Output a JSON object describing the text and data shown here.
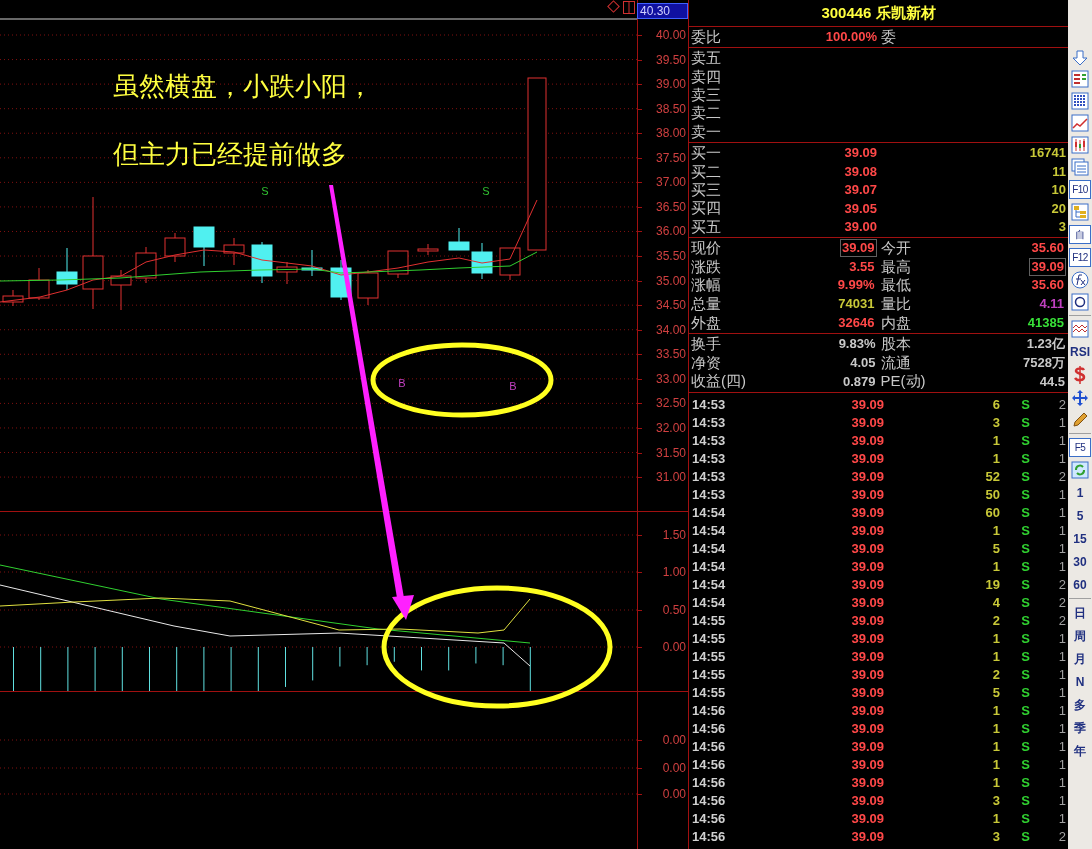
{
  "chart_header": {
    "current_price": "40.30"
  },
  "annotation": {
    "lines": [
      "虽然横盘，小跌小阳，",
      "但主力已经提前做多"
    ]
  },
  "signals": [
    {
      "kind": "sell",
      "label": "S"
    },
    {
      "kind": "sell",
      "label": "S"
    },
    {
      "kind": "buy",
      "label": "B"
    },
    {
      "kind": "buy",
      "label": "B"
    }
  ],
  "price_axis": {
    "ticks": [
      "40.00",
      "39.50",
      "39.00",
      "38.50",
      "38.00",
      "37.50",
      "37.00",
      "36.50",
      "36.00",
      "35.50",
      "35.00",
      "34.50",
      "34.00",
      "33.50",
      "33.00",
      "32.50",
      "32.00",
      "31.50",
      "31.00"
    ]
  },
  "indicator_axis": {
    "ticks": [
      "1.50",
      "1.00",
      "0.50",
      "0.00"
    ]
  },
  "lower_axis": {
    "ticks": [
      "0.00",
      "0.00",
      "0.00"
    ]
  },
  "quote": {
    "title": "300446 乐凯新材",
    "ratio": {
      "label": "委比",
      "value": "100.00%",
      "next_label": "委"
    },
    "asks": [
      {
        "label": "卖五"
      },
      {
        "label": "卖四"
      },
      {
        "label": "卖三"
      },
      {
        "label": "卖二"
      },
      {
        "label": "卖一"
      }
    ],
    "bids": [
      {
        "label": "买一",
        "price": "39.09",
        "volume": "16741"
      },
      {
        "label": "买二",
        "price": "39.08",
        "volume": "11"
      },
      {
        "label": "买三",
        "price": "39.07",
        "volume": "10"
      },
      {
        "label": "买四",
        "price": "39.05",
        "volume": "20"
      },
      {
        "label": "买五",
        "price": "39.00",
        "volume": "3"
      }
    ],
    "stats": [
      {
        "label": "现价",
        "value": "39.09",
        "color": "#ff4848",
        "boxed": true
      },
      {
        "label": "今开",
        "value": "35.60",
        "color": "#ff4848",
        "boxed": false
      },
      {
        "label": "涨跌",
        "value": "3.55",
        "color": "#ff4848",
        "boxed": false
      },
      {
        "label": "最高",
        "value": "39.09",
        "color": "#ff4848",
        "boxed": true
      },
      {
        "label": "涨幅",
        "value": "9.99%",
        "color": "#ff4848",
        "boxed": false
      },
      {
        "label": "最低",
        "value": "35.60",
        "color": "#ff4848",
        "boxed": false
      },
      {
        "label": "总量",
        "value": "74031",
        "color": "#c8c838",
        "boxed": false
      },
      {
        "label": "量比",
        "value": "4.11",
        "color": "#c040c0",
        "boxed": false
      },
      {
        "label": "外盘",
        "value": "32646",
        "color": "#ff4848",
        "boxed": false
      },
      {
        "label": "内盘",
        "value": "41385",
        "color": "#38e038",
        "boxed": false
      }
    ],
    "fundamentals": [
      {
        "label": "换手",
        "value": "9.83%"
      },
      {
        "label": "股本",
        "value": "1.23亿"
      },
      {
        "label": "净资",
        "value": "4.05"
      },
      {
        "label": "流通",
        "value": "7528万"
      },
      {
        "label": "收益(四)",
        "value": "0.879"
      },
      {
        "label": "PE(动)",
        "value": "44.5"
      }
    ]
  },
  "trades": [
    {
      "time": "14:53",
      "price": "39.09",
      "volume": "6",
      "side": "S",
      "count": "2"
    },
    {
      "time": "14:53",
      "price": "39.09",
      "volume": "3",
      "side": "S",
      "count": "1"
    },
    {
      "time": "14:53",
      "price": "39.09",
      "volume": "1",
      "side": "S",
      "count": "1"
    },
    {
      "time": "14:53",
      "price": "39.09",
      "volume": "1",
      "side": "S",
      "count": "1"
    },
    {
      "time": "14:53",
      "price": "39.09",
      "volume": "52",
      "side": "S",
      "count": "2"
    },
    {
      "time": "14:53",
      "price": "39.09",
      "volume": "50",
      "side": "S",
      "count": "1"
    },
    {
      "time": "14:54",
      "price": "39.09",
      "volume": "60",
      "side": "S",
      "count": "1"
    },
    {
      "time": "14:54",
      "price": "39.09",
      "volume": "1",
      "side": "S",
      "count": "1"
    },
    {
      "time": "14:54",
      "price": "39.09",
      "volume": "5",
      "side": "S",
      "count": "1"
    },
    {
      "time": "14:54",
      "price": "39.09",
      "volume": "1",
      "side": "S",
      "count": "1"
    },
    {
      "time": "14:54",
      "price": "39.09",
      "volume": "19",
      "side": "S",
      "count": "2"
    },
    {
      "time": "14:54",
      "price": "39.09",
      "volume": "4",
      "side": "S",
      "count": "2"
    },
    {
      "time": "14:55",
      "price": "39.09",
      "volume": "2",
      "side": "S",
      "count": "2"
    },
    {
      "time": "14:55",
      "price": "39.09",
      "volume": "1",
      "side": "S",
      "count": "1"
    },
    {
      "time": "14:55",
      "price": "39.09",
      "volume": "1",
      "side": "S",
      "count": "1"
    },
    {
      "time": "14:55",
      "price": "39.09",
      "volume": "2",
      "side": "S",
      "count": "1"
    },
    {
      "time": "14:55",
      "price": "39.09",
      "volume": "5",
      "side": "S",
      "count": "1"
    },
    {
      "time": "14:56",
      "price": "39.09",
      "volume": "1",
      "side": "S",
      "count": "1"
    },
    {
      "time": "14:56",
      "price": "39.09",
      "volume": "1",
      "side": "S",
      "count": "1"
    },
    {
      "time": "14:56",
      "price": "39.09",
      "volume": "1",
      "side": "S",
      "count": "1"
    },
    {
      "time": "14:56",
      "price": "39.09",
      "volume": "1",
      "side": "S",
      "count": "1"
    },
    {
      "time": "14:56",
      "price": "39.09",
      "volume": "1",
      "side": "S",
      "count": "1"
    },
    {
      "time": "14:56",
      "price": "39.09",
      "volume": "3",
      "side": "S",
      "count": "1"
    },
    {
      "time": "14:56",
      "price": "39.09",
      "volume": "1",
      "side": "S",
      "count": "1"
    },
    {
      "time": "14:56",
      "price": "39.09",
      "volume": "3",
      "side": "S",
      "count": "2"
    }
  ],
  "toolbar": [
    {
      "kind": "icon"
    },
    {
      "kind": "icon"
    },
    {
      "kind": "icon"
    },
    {
      "kind": "icon"
    },
    {
      "kind": "icon"
    },
    {
      "kind": "icon"
    },
    {
      "kind": "key",
      "label": "F10"
    },
    {
      "kind": "icon"
    },
    {
      "kind": "key",
      "label": "自"
    },
    {
      "kind": "key",
      "label": "F12"
    },
    {
      "kind": "icon"
    },
    {
      "kind": "icon"
    },
    {
      "kind": "separator"
    },
    {
      "kind": "icon"
    },
    {
      "kind": "period",
      "label": "RSI"
    },
    {
      "kind": "icon"
    },
    {
      "kind": "icon"
    },
    {
      "kind": "icon"
    },
    {
      "kind": "separator"
    },
    {
      "kind": "key",
      "label": "F5"
    },
    {
      "kind": "icon"
    },
    {
      "kind": "period",
      "label": "1"
    },
    {
      "kind": "period",
      "label": "5"
    },
    {
      "kind": "period",
      "label": "15"
    },
    {
      "kind": "period",
      "label": "30"
    },
    {
      "kind": "period",
      "label": "60"
    },
    {
      "kind": "separator"
    },
    {
      "kind": "period",
      "label": "日"
    },
    {
      "kind": "period",
      "label": "周"
    },
    {
      "kind": "period",
      "label": "月"
    },
    {
      "kind": "period",
      "label": "N"
    },
    {
      "kind": "period",
      "label": "多"
    },
    {
      "kind": "period",
      "label": "季"
    },
    {
      "kind": "period",
      "label": "年"
    }
  ]
}
